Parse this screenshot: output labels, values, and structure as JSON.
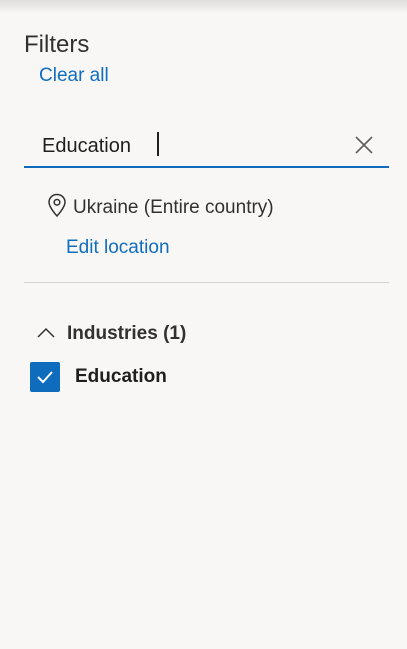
{
  "panel": {
    "title": "Filters",
    "clear_all_label": "Clear all"
  },
  "search": {
    "value": "Education",
    "clear_icon": "close-icon"
  },
  "location": {
    "icon": "map-pin-icon",
    "text": "Ukraine (Entire country)",
    "edit_label": "Edit location"
  },
  "industries": {
    "header_label": "Industries (1)",
    "expanded": true,
    "options": [
      {
        "label": "Education",
        "checked": true
      }
    ]
  },
  "colors": {
    "background": "#f8f7f6",
    "link": "#106ebe",
    "accent": "#0f6cbd",
    "text": "#201f1e",
    "divider": "#d6d4d2"
  }
}
